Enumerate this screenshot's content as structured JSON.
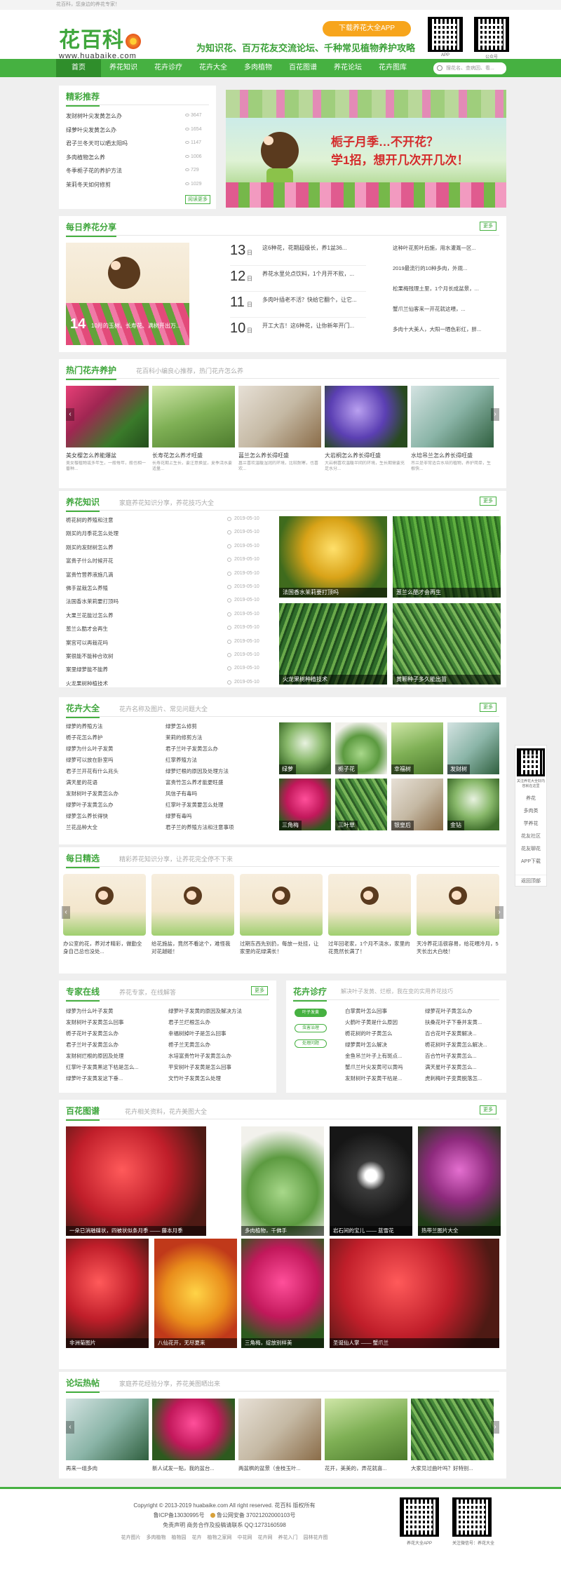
{
  "topbar": {
    "text": "花百科，您身边的养花专家！"
  },
  "header": {
    "logo_cn": "花百科",
    "logo_en": "www.huabaike.com",
    "app_button": "下载养花大全APP",
    "slogan": "为知识花、百万花友交流论坛、千种常见植物养护攻略",
    "qr1_label": "APP",
    "qr2_label": "公众号"
  },
  "nav": {
    "items": [
      "首页",
      "养花知识",
      "花卉诊疗",
      "花卉大全",
      "多肉植物",
      "百花图谱",
      "养花论坛",
      "花卉图库"
    ],
    "search_placeholder": "搜花名、查病因、看..."
  },
  "featured": {
    "title": "精彩推荐",
    "items": [
      {
        "text": "发财树叶尖发黄怎么办",
        "count": "3647"
      },
      {
        "text": "绿萝叶尖发黄怎么办",
        "count": "1654"
      },
      {
        "text": "君子兰冬天可以晒太阳吗",
        "count": "1147"
      },
      {
        "text": "多肉植物怎么养",
        "count": "1006"
      },
      {
        "text": "冬季栀子花的养护方法",
        "count": "729"
      },
      {
        "text": "茉莉冬天如何修剪",
        "count": "1029"
      }
    ],
    "more": "阅读更多",
    "banner_line1": "栀子月季…不开花？",
    "banner_line2": "学1招，想开几次开几次！"
  },
  "daily": {
    "title": "每日养花分享",
    "more": "更多",
    "hero_day": "14",
    "hero_caption": "10月的玉树、长寿花、满树开出万...",
    "entries": [
      {
        "day": "13",
        "month": "日",
        "text": "这6种花，花期超级长，养1盆36..."
      },
      {
        "day": "12",
        "month": "日",
        "text": "养花水里兑点饮料，1个月开不败，..."
      },
      {
        "day": "11",
        "month": "日",
        "text": "多肉叶插老不活？快给它翻个，让它..."
      },
      {
        "day": "10",
        "month": "日",
        "text": "开工大吉！这6种花，让你新年开门..."
      }
    ],
    "right": [
      "这种叶花剪叶后施，用水灌溉一区...",
      "2019最流行的10种多肉，外观...",
      "松果梅残理土里，1个月长成盆景，...",
      "蟹爪兰仙客来一开花就这喂，...",
      "多肉十大美人，大阳一晒色彩红，胖..."
    ]
  },
  "hot": {
    "title": "热门花卉养护",
    "subtitle": "花百科小编良心推荐，热门花卉怎么养",
    "items": [
      {
        "title": "美女樱怎么养能爆盆",
        "desc": "美女樱植物或多年生，一般每年，般也相一番种..."
      },
      {
        "title": "长寿花怎么养才旺盛",
        "desc": "长寿花期上生长，要注意换盆，夏季浇水要适量..."
      },
      {
        "title": "菖兰怎么养长得旺盛",
        "desc": "菖兰喜欢温暖湿润的环境，比较耐寒，也喜欢..."
      },
      {
        "title": "大岩桐怎么养长得旺盛",
        "desc": "大岩桐喜欢温暖半阴的环境，生长期需要充足水分..."
      },
      {
        "title": "水培吊兰怎么养长得旺盛",
        "desc": "吊兰是非常适合水培的植物，养护简单，生根快..."
      }
    ]
  },
  "knowledge": {
    "title": "养花知识",
    "subtitle": "家庭养花知识分享，养花技巧大全",
    "more": "更多",
    "items": [
      {
        "text": "栀花树的养殖和注意",
        "date": "2019-05-10"
      },
      {
        "text": "刚买的月季花怎么处理",
        "date": "2019-05-10"
      },
      {
        "text": "刚买的发财树怎么养",
        "date": "2019-05-10"
      },
      {
        "text": "富贵子什么时候开花",
        "date": "2019-05-10"
      },
      {
        "text": "富贵竹营养液施几滴",
        "date": "2019-05-10"
      },
      {
        "text": "佛手盆栽怎么养殖",
        "date": "2019-05-10"
      },
      {
        "text": "法国香水茉莉要打顶吗",
        "date": "2019-05-10"
      },
      {
        "text": "大果兰花能过怎么养",
        "date": "2019-05-10"
      },
      {
        "text": "葱兰么酷才会再生",
        "date": "2019-05-10"
      },
      {
        "text": "案宫可以再栽花吗",
        "date": "2019-05-10"
      },
      {
        "text": "案很能不能种合欢树",
        "date": "2019-05-10"
      },
      {
        "text": "案里绿萝能不能养",
        "date": "2019-05-10"
      },
      {
        "text": "火龙果树种植技术",
        "date": "2019-05-10"
      }
    ],
    "photos": [
      "法国香水茉莉要打顶吗",
      "葱兰么酷才会再生",
      "火龙果树种植技术",
      "黄颗种子多久能出苗"
    ]
  },
  "encyclopedia": {
    "title": "花卉大全",
    "subtitle": "花卉名称及图片、常见问题大全",
    "more": "更多",
    "col1": [
      "绿萝的养殖方法",
      "栀子花怎么养护",
      "绿萝为什么叶子发黄",
      "绿萝可以放在卧室吗",
      "君子兰开花有什么兆头",
      "满天星的花语",
      "发财树叶子发黄怎么办",
      "绿萝叶子发黄怎么办",
      "绿萝怎么养长得快",
      "兰花品种大全"
    ],
    "col2": [
      "绿萝怎么修剪",
      "茉莉的修剪方法",
      "君子兰叶子发黄怎么办",
      "红掌养殖方法",
      "绿萝烂根的原因及处理方法",
      "富贵竹怎么养才能更旺盛",
      "风信子有毒吗",
      "红掌叶子发黄要怎么处理",
      "绿萝有毒吗",
      "君子兰的养殖方法和注意事项"
    ],
    "plants": [
      "绿萝",
      "栀子花",
      "幸福树",
      "发财树",
      "三角梅",
      "三叶草",
      "银皇后",
      "金钻"
    ]
  },
  "selected": {
    "title": "每日精选",
    "subtitle": "精彩养花知识分享，让养花完全停不下来",
    "items": [
      "办公室的花，养对才精彩，做勤全身自己总也没处...",
      "给花施盐，竟然不看这个，难怪我对花越碰！",
      "过期东西先别扔，每放一处挂，让家里的花绿满长！",
      "过年回老家，1个月不浇水，家里的花竟然长满了！",
      "天冷养花活很容易，给花喂冷月，5天长出大白枝！"
    ]
  },
  "experts": {
    "title": "专家在线",
    "subtitle": "养花专家，在线解答",
    "more": "更多",
    "col1": [
      "绿萝为什么叶子发黄",
      "发财树叶子发黄怎么回事",
      "栀子花叶子发黄怎么办",
      "君子兰叶子发黄怎么办",
      "发财树烂根的原因及处理",
      "红掌叶子发黄黑这下枯是怎么...",
      "绿萝叶子发黄发这下垂..."
    ],
    "col2": [
      "绿萝叶子发黄的原因及解决方法",
      "君子兰烂根怎么办",
      "幸福树掉叶子是怎么回事",
      "栀子兰无黄怎么办",
      "水培富贵竹叶子发黄怎么办",
      "平安树叶子发黄是怎么回事",
      "文竹叶子发黄怎么处理"
    ]
  },
  "diagnosis": {
    "title": "花卉诊疗",
    "subtitle": "解决叶子发黄、烂根，我在变的实用养花技巧",
    "tabs": [
      "叶子发黄",
      "虫害治理",
      "处理问题"
    ],
    "col1": [
      "白掌黄叶怎么回事",
      "火鹤叶子黄是什么原因",
      "栀花树的叶子黄怎么",
      "绿萝黄叶怎么解决",
      "金鱼吊兰叶子上有斑点...",
      "蟹爪兰叶尖发黄可以黄吗",
      "发财树叶子发黄干枯是..."
    ],
    "col2": [
      "绿萝花叶子黄怎么办",
      "扶桑花叶子下垂并发黄...",
      "百合花叶子发黄解决...",
      "栀花树叶子发黄怎么解决...",
      "百合竹叶子发黄怎么...",
      "满天星叶子发黄怎么...",
      "虎刺梅叶子变黄脱落怎..."
    ]
  },
  "gallery": {
    "title": "百花图谱",
    "subtitle": "花卉相关资料，花卉美图大全",
    "more": "更多",
    "items": [
      "一朵已消融碟状，四被状似条月季 —— 藤本月季",
      "多肉植物，千佛手",
      "岩石间的宝儿 —— 蓝雪花",
      "热带兰图片大全",
      "非洲菊图片",
      "八仙花开，无尽夏来",
      "三角梅，绽放别样美",
      "圣诞仙人掌 —— 蟹爪兰"
    ]
  },
  "forum": {
    "title": "论坛热帖",
    "subtitle": "家庭养花经验分享，养花美图晒出来",
    "items": [
      "再来一组多肉",
      "新人试发一贴，我的盆台...",
      "两盆枫的盆景（金枝玉叶...",
      "花开，美美的，弄花就喜...",
      "大家见过曲叶吗？好特别..."
    ]
  },
  "floatbar": {
    "qr_label": "关注养花大全好内容就在这里",
    "items": [
      "养花",
      "多肉类",
      "学养花",
      "花友社区",
      "花友聊花",
      "APP下载",
      "返回顶部"
    ]
  },
  "footer": {
    "copyright": "Copyright © 2013-2019 huabaike.com All right reserved. 花百科 版权所有",
    "icp": "鲁ICP备13030995号",
    "police": "鲁公网安备 37021202000103号",
    "contact": "免责声明  商务合作及投稿请联系 QQ:1273160598",
    "links": [
      "花卉图片",
      "多肉植物",
      "植物园",
      "花卉",
      "植物之家网",
      "中花网",
      "花卉网",
      "养花入门",
      "园林花卉图"
    ],
    "qr1_label": "养花大全APP",
    "qr2_label": "关注微信号：养花大全"
  }
}
